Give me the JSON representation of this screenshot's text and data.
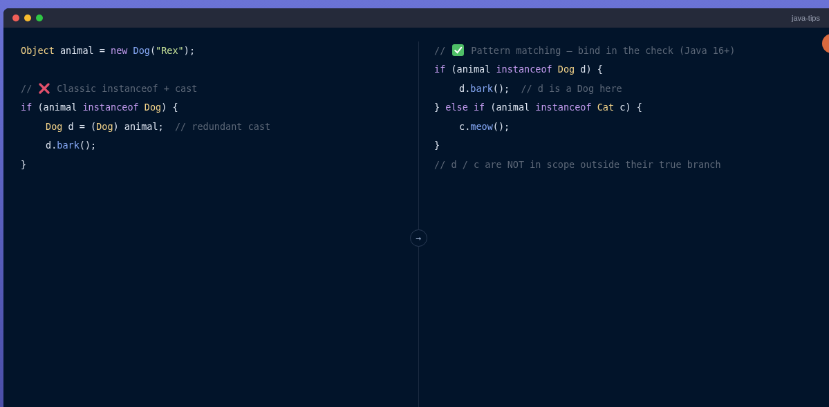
{
  "window": {
    "title": "java-tips"
  },
  "panels": [
    {
      "lines": [
        {
          "indented": false,
          "gap_before": false,
          "tokens": [
            {
              "kind": "type",
              "text": "Object"
            },
            {
              "kind": "plain",
              "text": " animal = "
            },
            {
              "kind": "keyword",
              "text": "new "
            },
            {
              "kind": "method",
              "text": "Dog"
            },
            {
              "kind": "plain",
              "text": "("
            },
            {
              "kind": "string",
              "text": "\"Rex\""
            },
            {
              "kind": "plain",
              "text": ");"
            }
          ]
        },
        {
          "indented": false,
          "gap_before": true,
          "tokens": [
            {
              "kind": "comment",
              "text": "//"
            },
            {
              "kind": "cross"
            },
            {
              "kind": "comment",
              "text": "Classic instanceof + cast"
            }
          ]
        },
        {
          "indented": false,
          "gap_before": false,
          "tokens": [
            {
              "kind": "keyword",
              "text": "if"
            },
            {
              "kind": "plain",
              "text": " (animal "
            },
            {
              "kind": "keyword",
              "text": "instanceof "
            },
            {
              "kind": "type",
              "text": "Dog"
            },
            {
              "kind": "plain",
              "text": ") {"
            }
          ]
        },
        {
          "indented": true,
          "gap_before": false,
          "tokens": [
            {
              "kind": "type",
              "text": "Dog"
            },
            {
              "kind": "plain",
              "text": " d = ("
            },
            {
              "kind": "type",
              "text": "Dog"
            },
            {
              "kind": "plain",
              "text": ") animal;  "
            },
            {
              "kind": "comment",
              "text": "// redundant cast"
            }
          ]
        },
        {
          "indented": true,
          "gap_before": false,
          "tokens": [
            {
              "kind": "plain",
              "text": "d."
            },
            {
              "kind": "method",
              "text": "bark"
            },
            {
              "kind": "plain",
              "text": "();"
            }
          ]
        },
        {
          "indented": false,
          "gap_before": false,
          "tokens": [
            {
              "kind": "plain",
              "text": "}"
            }
          ]
        }
      ]
    },
    {
      "lines": [
        {
          "indented": false,
          "gap_before": false,
          "tokens": [
            {
              "kind": "comment",
              "text": "//"
            },
            {
              "kind": "check"
            },
            {
              "kind": "comment",
              "text": "Pattern matching — bind in the check (Java 16+)"
            }
          ]
        },
        {
          "indented": false,
          "gap_before": false,
          "tokens": [
            {
              "kind": "keyword",
              "text": "if"
            },
            {
              "kind": "plain",
              "text": " (animal "
            },
            {
              "kind": "keyword",
              "text": "instanceof "
            },
            {
              "kind": "type",
              "text": "Dog"
            },
            {
              "kind": "plain",
              "text": " d) {"
            }
          ]
        },
        {
          "indented": true,
          "gap_before": false,
          "tokens": [
            {
              "kind": "plain",
              "text": "d."
            },
            {
              "kind": "method",
              "text": "bark"
            },
            {
              "kind": "plain",
              "text": "();  "
            },
            {
              "kind": "comment",
              "text": "// d is a Dog here"
            }
          ]
        },
        {
          "indented": false,
          "gap_before": false,
          "tokens": [
            {
              "kind": "plain",
              "text": "} "
            },
            {
              "kind": "keyword",
              "text": "else if"
            },
            {
              "kind": "plain",
              "text": " (animal "
            },
            {
              "kind": "keyword",
              "text": "instanceof "
            },
            {
              "kind": "type",
              "text": "Cat"
            },
            {
              "kind": "plain",
              "text": " c) {"
            }
          ]
        },
        {
          "indented": true,
          "gap_before": false,
          "tokens": [
            {
              "kind": "plain",
              "text": "c."
            },
            {
              "kind": "method",
              "text": "meow"
            },
            {
              "kind": "plain",
              "text": "();"
            }
          ]
        },
        {
          "indented": false,
          "gap_before": false,
          "tokens": [
            {
              "kind": "plain",
              "text": "}"
            }
          ]
        },
        {
          "indented": false,
          "gap_before": false,
          "tokens": [
            {
              "kind": "comment",
              "text": "// d / c are NOT in scope outside their true branch"
            }
          ]
        }
      ]
    }
  ],
  "divider": {
    "symbol": "→"
  }
}
